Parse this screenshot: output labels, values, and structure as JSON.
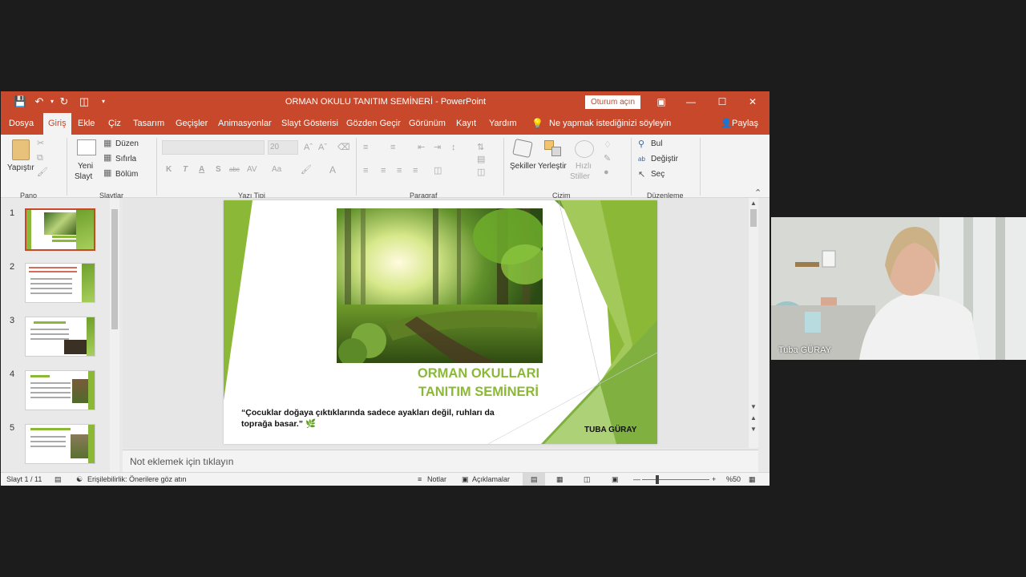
{
  "titlebar": {
    "doc_title": "ORMAN OKULU TANITIM SEMİNERİ  -  PowerPoint",
    "signin_label": "Oturum açın"
  },
  "menu": {
    "tabs": [
      "Dosya",
      "Giriş",
      "Ekle",
      "Çiz",
      "Tasarım",
      "Geçişler",
      "Animasyonlar",
      "Slayt Gösterisi",
      "Gözden Geçir",
      "Görünüm",
      "Kayıt",
      "Yardım"
    ],
    "active_tab": "Giriş",
    "tell_me": "Ne yapmak istediğinizi söyleyin",
    "share": "Paylaş"
  },
  "ribbon": {
    "pano": {
      "paste": "Yapıştır",
      "group": "Pano"
    },
    "slaytlar": {
      "new_slide_1": "Yeni",
      "new_slide_2": "Slayt",
      "layout": "Düzen",
      "reset": "Sıfırla",
      "section": "Bölüm",
      "group": "Slaytlar"
    },
    "yazi_tipi": {
      "font_size": "20",
      "bold": "K",
      "italic": "T",
      "underline": "A",
      "shadow": "S",
      "strike": "abc",
      "spacing": "AV",
      "case": "Aa",
      "font_color": "A",
      "group": "Yazı Tipi"
    },
    "paragraf": {
      "group": "Paragraf"
    },
    "cizim": {
      "shapes": "Şekiller",
      "arrange": "Yerleştir",
      "quick_styles_1": "Hızlı",
      "quick_styles_2": "Stiller",
      "group": "Çizim"
    },
    "duzenleme": {
      "find": "Bul",
      "replace": "Değiştir",
      "select": "Seç",
      "group": "Düzenleme"
    }
  },
  "thumbnails": {
    "numbers": [
      "1",
      "2",
      "3",
      "4",
      "5"
    ],
    "selected": 1
  },
  "slide": {
    "title_line1": "ORMAN OKULLARI",
    "title_line2": "TANITIM SEMİNERİ",
    "quote": "“Çocuklar doğaya çıktıklarında sadece ayakları değil, ruhları da toprağa basar.”",
    "author": "TUBA GÜRAY"
  },
  "notes": {
    "placeholder": "Not eklemek için tıklayın"
  },
  "status": {
    "slide_counter": "Slayt 1 / 11",
    "accessibility": "Erişilebilirlik: Önerilere göz atın",
    "notes_btn": "Notlar",
    "comments_btn": "Açıklamalar",
    "zoom": "%50"
  },
  "video": {
    "participant_name": "Tuba GÜRAY"
  },
  "colors": {
    "accent": "#c7482b",
    "slide_green": "#8cb837"
  }
}
